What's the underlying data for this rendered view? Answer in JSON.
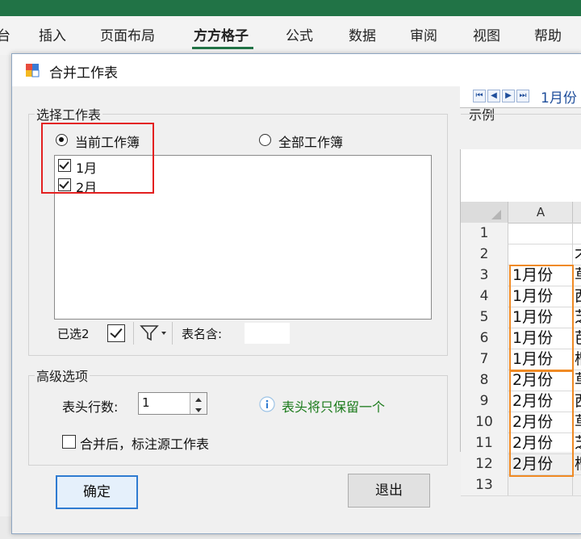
{
  "ribbon": {
    "tabs": [
      "台",
      "插入",
      "页面布局",
      "方方格子",
      "公式",
      "数据",
      "审阅",
      "视图",
      "帮助"
    ],
    "active_tab": "方方格子"
  },
  "dialog": {
    "title": "合并工作表",
    "select_group_label": "选择工作表",
    "radio_current": "当前工作簿",
    "radio_all": "全部工作簿",
    "sheets": [
      "1月",
      "2月"
    ],
    "selected_label": "已选2",
    "name_contains_label": "表名含:",
    "name_contains_value": "",
    "advanced_group_label": "高级选项",
    "header_rows_label": "表头行数:",
    "header_rows_value": "1",
    "info_text": "表头将只保留一个",
    "mark_source_label": "合并后，标注源工作表",
    "ok_button": "确定",
    "exit_button": "退出"
  },
  "example": {
    "label": "示例",
    "sheet_tab": "1月份",
    "column_header": "A",
    "rows": [
      {
        "num": "1",
        "a": "",
        "b": ""
      },
      {
        "num": "2",
        "a": "",
        "b": "才"
      },
      {
        "num": "3",
        "a": "1月份",
        "b": "草"
      },
      {
        "num": "4",
        "a": "1月份",
        "b": "西"
      },
      {
        "num": "5",
        "a": "1月份",
        "b": "芝"
      },
      {
        "num": "6",
        "a": "1月份",
        "b": "芭"
      },
      {
        "num": "7",
        "a": "1月份",
        "b": "榴"
      },
      {
        "num": "8",
        "a": "2月份",
        "b": "草"
      },
      {
        "num": "9",
        "a": "2月份",
        "b": "西"
      },
      {
        "num": "10",
        "a": "2月份",
        "b": "草"
      },
      {
        "num": "11",
        "a": "2月份",
        "b": "芝"
      },
      {
        "num": "12",
        "a": "2月份",
        "b": "榴"
      },
      {
        "num": "13",
        "a": "",
        "b": ""
      }
    ]
  },
  "colors": {
    "excel_green": "#217346",
    "highlight_red": "#e32020",
    "highlight_orange": "#f08a24",
    "info_green": "#1a7a1a"
  }
}
